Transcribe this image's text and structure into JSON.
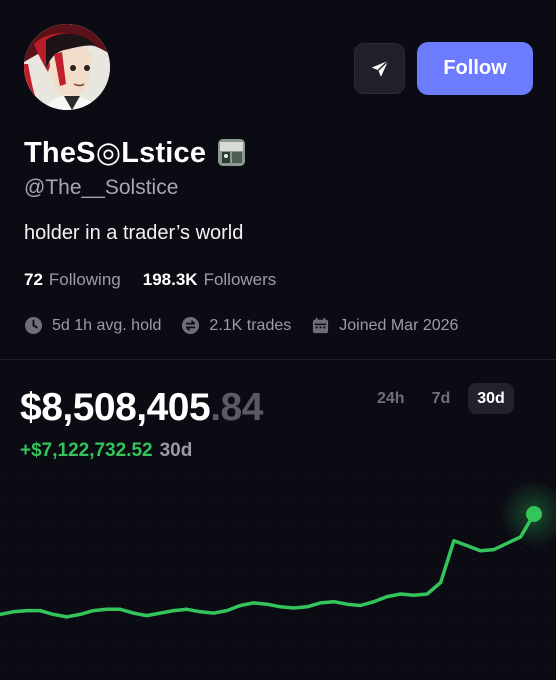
{
  "profile": {
    "display_name": "TheS◎Lstice",
    "handle": "@The__Solstice",
    "bio": "holder in a trader’s world"
  },
  "actions": {
    "follow_label": "Follow",
    "share_icon": "send-icon"
  },
  "stats": {
    "following_count": "72",
    "following_label": "Following",
    "followers_count": "198.3K",
    "followers_label": "Followers"
  },
  "meta": {
    "hold_time": "5d 1h avg. hold",
    "trades": "2.1K trades",
    "joined": "Joined Mar 2026"
  },
  "portfolio": {
    "balance_main": "$8,508,405",
    "balance_cents": ".84",
    "change_value": "+$7,122,732.52",
    "change_period": "30d"
  },
  "range_tabs": [
    {
      "label": "24h",
      "active": false
    },
    {
      "label": "7d",
      "active": false
    },
    {
      "label": "30d",
      "active": true
    }
  ],
  "colors": {
    "accent": "#6d7cff",
    "positive": "#33c45a",
    "background": "#0b0b14"
  },
  "chart_data": {
    "type": "line",
    "title": "",
    "xlabel": "",
    "ylabel": "",
    "grid": false,
    "series": [
      {
        "values": [
          0.6,
          0.8,
          0.9,
          0.9,
          0.6,
          0.4,
          0.6,
          0.9,
          1.0,
          1.0,
          0.7,
          0.5,
          0.7,
          0.9,
          1.0,
          0.8,
          0.7,
          0.9,
          1.3,
          1.5,
          1.4,
          1.2,
          1.1,
          1.2,
          1.5,
          1.6,
          1.4,
          1.3,
          1.6,
          2.0,
          2.2,
          2.1,
          2.2,
          3.1,
          6.4,
          6.0,
          5.6,
          5.7,
          6.2,
          6.7,
          8.5
        ]
      }
    ]
  }
}
